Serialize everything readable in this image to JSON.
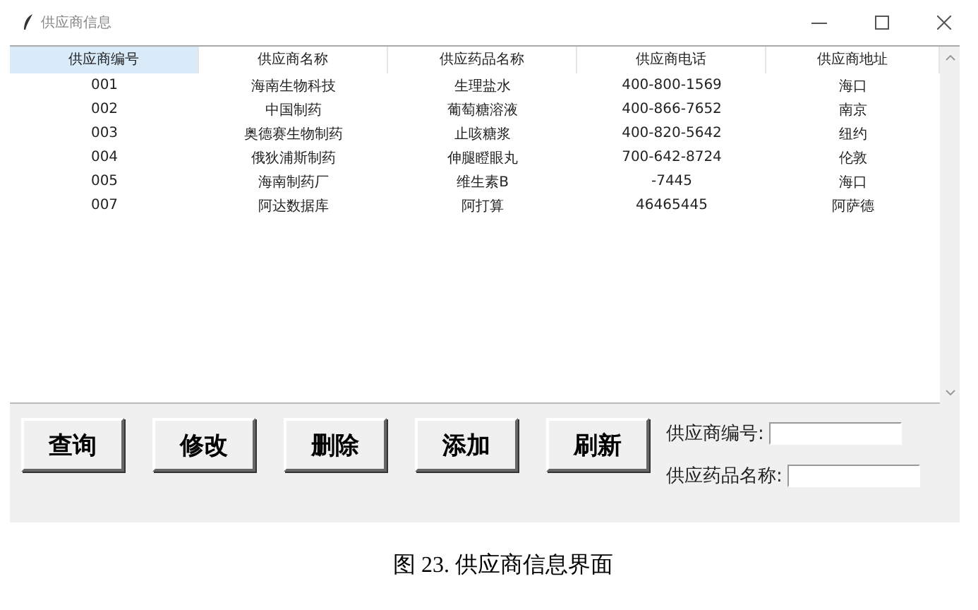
{
  "window": {
    "title": "供应商信息"
  },
  "table": {
    "columns": [
      {
        "label": "供应商编号",
        "selected": true
      },
      {
        "label": "供应商名称",
        "selected": false
      },
      {
        "label": "供应药品名称",
        "selected": false
      },
      {
        "label": "供应商电话",
        "selected": false
      },
      {
        "label": "供应商地址",
        "selected": false
      }
    ],
    "rows": [
      [
        "001",
        "海南生物科技",
        "生理盐水",
        "400-800-1569",
        "海口"
      ],
      [
        "002",
        "中国制药",
        "葡萄糖溶液",
        "400-866-7652",
        "南京"
      ],
      [
        "003",
        "奥德赛生物制药",
        "止咳糖浆",
        "400-820-5642",
        "纽约"
      ],
      [
        "004",
        "俄狄浦斯制药",
        "伸腿瞪眼丸",
        "700-642-8724",
        "伦敦"
      ],
      [
        "005",
        "海南制药厂",
        "维生素B",
        "-7445",
        "海口"
      ],
      [
        "007",
        "阿达数据库",
        "阿打算",
        "46465445",
        "阿萨德"
      ]
    ]
  },
  "buttons": [
    "查询",
    "修改",
    "删除",
    "添加",
    "刷新"
  ],
  "fields": [
    {
      "label": "供应商编号:"
    },
    {
      "label": "供应药品名称:"
    }
  ],
  "caption": "图 23. 供应商信息界面"
}
